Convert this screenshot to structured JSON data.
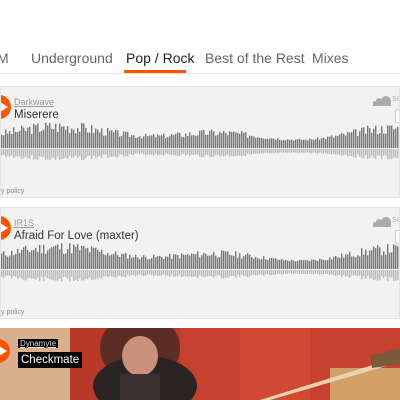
{
  "tabs": [
    {
      "label": "M"
    },
    {
      "label": "Underground"
    },
    {
      "label": "Pop / Rock",
      "active": true
    },
    {
      "label": "Best of the Rest"
    },
    {
      "label": "Mixes"
    }
  ],
  "players": [
    {
      "artist": "Darkwave",
      "title": "Miserere",
      "brand": "SO",
      "policy": "y policy"
    },
    {
      "artist": "IR1S",
      "title": "Afraid For Love (maxter)",
      "brand": "SO",
      "policy": "y policy"
    },
    {
      "artist": "Dynamyte",
      "title": "Checkmate"
    }
  ],
  "colors": {
    "accent": "#ff5500",
    "wave": "#777777",
    "widget_bg": "#f2f2f2"
  },
  "icons": {
    "play": "play-icon",
    "brand": "soundcloud-icon"
  }
}
